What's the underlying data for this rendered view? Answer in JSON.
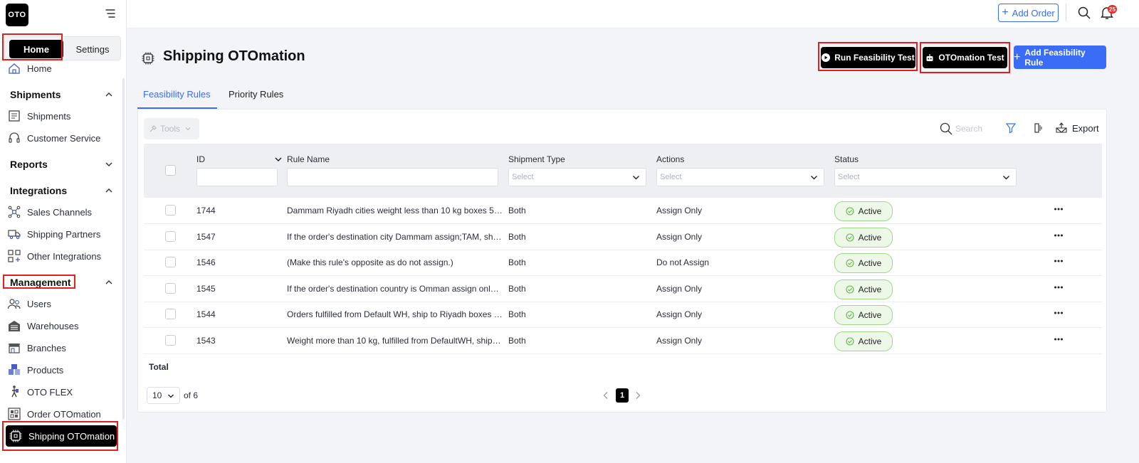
{
  "app": {
    "logo_text": "OTO"
  },
  "sidebar": {
    "tabs": {
      "home": "Home",
      "settings": "Settings"
    },
    "home_item": "Home",
    "sections": {
      "shipments": "Shipments",
      "reports": "Reports",
      "integrations": "Integrations",
      "management": "Management"
    },
    "items": {
      "shipments": "Shipments",
      "customer_service": "Customer Service",
      "sales_channels": "Sales Channels",
      "shipping_partners": "Shipping Partners",
      "other_integrations": "Other Integrations",
      "users": "Users",
      "warehouses": "Warehouses",
      "branches": "Branches",
      "products": "Products",
      "oto_flex": "OTO FLEX",
      "order_otomation": "Order OTOmation",
      "shipping_otomation": "Shipping OTOmation"
    }
  },
  "topbar": {
    "add_order": "Add Order",
    "notifications_count": "25"
  },
  "header": {
    "title": "Shipping OTOmation",
    "run_feasibility": "Run Feasibility Test",
    "otomation_test": "OTOmation Test",
    "add_rule": "Add Feasibility Rule"
  },
  "tabs": {
    "feasibility": "Feasibility Rules",
    "priority": "Priority Rules"
  },
  "toolbar": {
    "tools": "Tools",
    "search_placeholder": "Search",
    "export": "Export"
  },
  "table": {
    "columns": {
      "id": "ID",
      "rule_name": "Rule Name",
      "shipment_type": "Shipment Type",
      "actions": "Actions",
      "status": "Status"
    },
    "select_placeholder": "Select",
    "rows": [
      {
        "id": "1744",
        "name": "Dammam Riyadh cities weight less than 10 kg boxes 5, s...",
        "type": "Both",
        "action": "Assign Only",
        "status": "Active"
      },
      {
        "id": "1547",
        "name": "If the order's destination city Dammam assign;TAM, shg...",
        "type": "Both",
        "action": "Assign Only",
        "status": "Active"
      },
      {
        "id": "1546",
        "name": "(Make this rule's opposite as do not assign.)",
        "type": "Both",
        "action": "Do not Assign",
        "status": "Active"
      },
      {
        "id": "1545",
        "name": "If the order's destination country is Omman assign only ...",
        "type": "Both",
        "action": "Assign Only",
        "status": "Active"
      },
      {
        "id": "1544",
        "name": "Orders fulfilled from Default WH, ship to Riyadh boxes co...",
        "type": "Both",
        "action": "Assign Only",
        "status": "Active"
      },
      {
        "id": "1543",
        "name": "Weight more than 10 kg, fulfilled from DefaultWH, ship t...",
        "type": "Both",
        "action": "Assign Only",
        "status": "Active"
      }
    ],
    "total_label": "Total"
  },
  "pagination": {
    "page_size": "10",
    "of_pages": "of 6",
    "current": "1"
  },
  "colors": {
    "accent": "#3b6cf5",
    "active_bg": "#eef8e8",
    "active_border": "#9fd88a",
    "highlight": "#e02020"
  }
}
